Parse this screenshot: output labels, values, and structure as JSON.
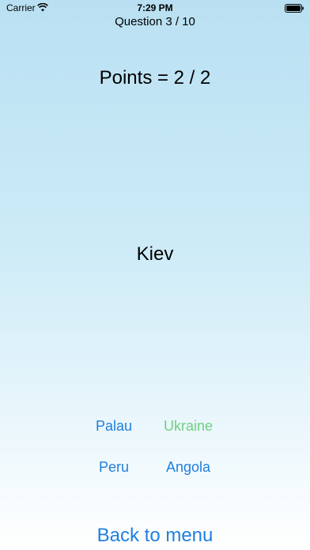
{
  "status_bar": {
    "carrier": "Carrier",
    "time": "7:29 PM"
  },
  "quiz": {
    "question_counter": "Question 3 / 10",
    "points": "Points = 2 / 2",
    "prompt": "Kiev",
    "answers": [
      "Palau",
      "Ukraine",
      "Peru",
      "Angola"
    ],
    "correct_answer": "Ukraine"
  },
  "footer": {
    "back_label": "Back to menu"
  },
  "colors": {
    "accent": "#1f7fe0",
    "correct": "#6fcf83",
    "background_top": "#b9e0f2",
    "background_bottom": "#ffffff"
  },
  "icons": [
    "wifi-icon",
    "battery-icon"
  ]
}
